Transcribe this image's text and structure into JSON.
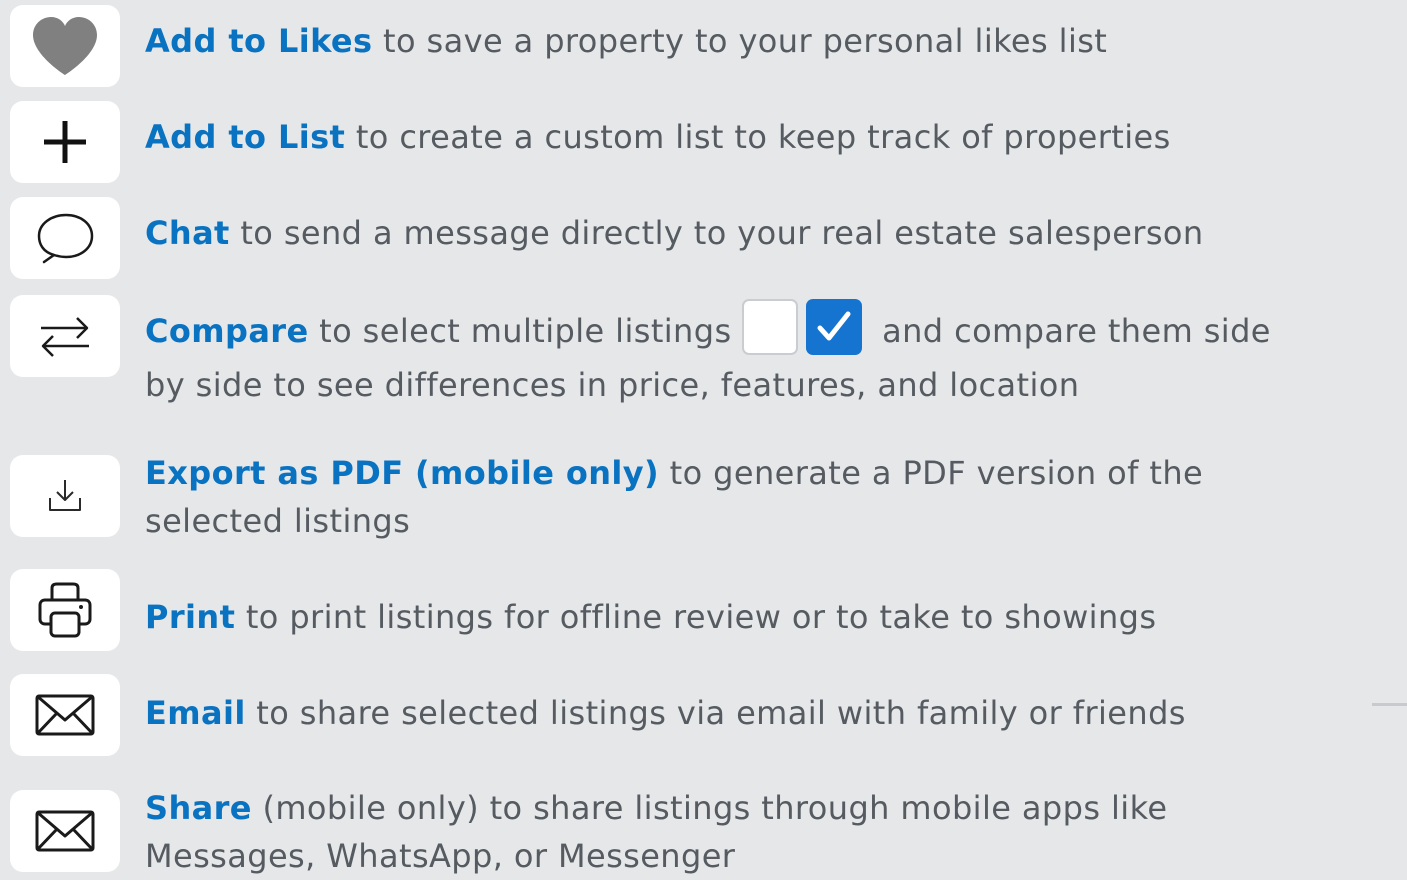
{
  "items": [
    {
      "icon": "heart-icon",
      "keyword": "Add to Likes",
      "description": " to save a property to your personal likes list"
    },
    {
      "icon": "plus-icon",
      "keyword": "Add to List",
      "description": " to create a custom list to keep track of properties"
    },
    {
      "icon": "chat-bubble-icon",
      "keyword": "Chat",
      "description": " to send a message directly to your real estate salesperson"
    },
    {
      "icon": "compare-arrows-icon",
      "keyword": "Compare",
      "description_before": " to select multiple listings",
      "description_after": " and compare them side",
      "description_line2": "by side to see differences in price, features, and location"
    },
    {
      "icon": "download-icon",
      "keyword": "Export as PDF (mobile only)",
      "description": " to generate a PDF version of the",
      "description_line2": "selected listings"
    },
    {
      "icon": "printer-icon",
      "keyword": "Print",
      "description": " to print listings for offline review or to take to showings"
    },
    {
      "icon": "envelope-icon",
      "keyword": "Email",
      "description": " to share selected listings via email with family or friends"
    },
    {
      "icon": "envelope-icon",
      "keyword": "Share",
      "description": " (mobile only) to share listings through mobile apps like",
      "description_line2": "Messages, WhatsApp, or Messenger"
    }
  ],
  "colors": {
    "background": "#e6e7e9",
    "keyword": "#0a73c1",
    "body_text": "#555b61",
    "checkbox_checked": "#1474d0"
  }
}
